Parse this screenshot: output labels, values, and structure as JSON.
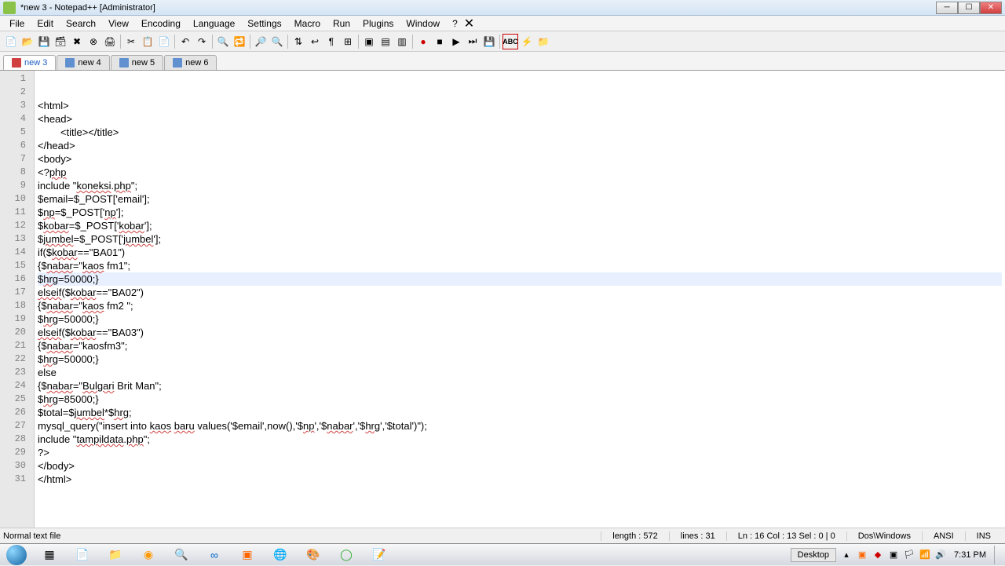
{
  "window": {
    "title": "*new 3 - Notepad++ [Administrator]"
  },
  "menu": {
    "items": [
      "File",
      "Edit",
      "Search",
      "View",
      "Encoding",
      "Language",
      "Settings",
      "Macro",
      "Run",
      "Plugins",
      "Window",
      "?"
    ]
  },
  "tabs": [
    {
      "label": "new  3",
      "active": true
    },
    {
      "label": "new  4",
      "active": false
    },
    {
      "label": "new  5",
      "active": false
    },
    {
      "label": "new  6",
      "active": false
    }
  ],
  "code_lines": [
    "",
    "",
    "<html>",
    "<head>",
    "        <title></title>",
    "</head>",
    "<body>",
    "<?php",
    "include \"koneksi.php\";",
    "$email=$_POST['email'];",
    "$np=$_POST['np'];",
    "$kobar=$_POST['kobar'];",
    "$jumbel=$_POST['jumbel'];",
    "if($kobar==\"BA01\")",
    "{$nabar=\"kaos fm1\";",
    "$hrg=50000;}",
    "elseif($kobar==\"BA02\")",
    "{$nabar=\"kaos fm2 \";",
    "$hrg=50000;}",
    "elseif($kobar==\"BA03\")",
    "{$nabar=\"kaosfm3\";",
    "$hrg=50000;}",
    "else",
    "{$nabar=\"Bulgari Brit Man\";",
    "$hrg=85000;}",
    "$total=$jumbel*$hrg;",
    "mysql_query(\"insert into kaos baru values('$email',now(),'$np','$nabar','$hrg','$total')\");",
    "include \"tampildata.php\";",
    "?>",
    "</body>",
    "</html>"
  ],
  "highlight_line": 16,
  "status": {
    "left": "Normal text file",
    "length": "length : 572",
    "lines": "lines : 31",
    "pos": "Ln : 16    Col : 13    Sel : 0 | 0",
    "eol": "Dos\\Windows",
    "encoding": "ANSI",
    "mode": "INS"
  },
  "taskbar": {
    "desktop": "Desktop",
    "clock": "7:31 PM"
  }
}
